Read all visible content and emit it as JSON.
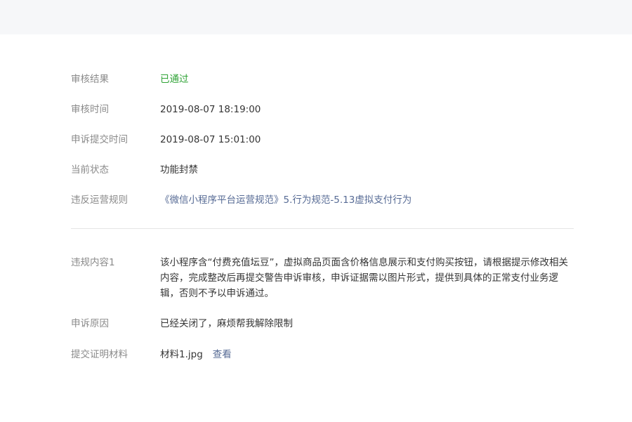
{
  "review": {
    "result_label": "审核结果",
    "result_value": "已通过",
    "time_label": "审核时间",
    "time_value": "2019-08-07 18:19:00",
    "appeal_time_label": "申诉提交时间",
    "appeal_time_value": "2019-08-07 15:01:00",
    "status_label": "当前状态",
    "status_value": "功能封禁",
    "rule_label": "违反运营规则",
    "rule_value": "《微信小程序平台运营规范》5.行为规范-5.13虚拟支付行为"
  },
  "violation": {
    "content_label": "违规内容1",
    "content_value": "该小程序含“付费充值坛豆”，虚拟商品页面含价格信息展示和支付购买按钮，请根据提示修改相关内容，完成整改后再提交警告申诉审核，申诉证据需以图片形式，提供到具体的正常支付业务逻辑，否则不予以申诉通过。",
    "reason_label": "申诉原因",
    "reason_value": "已经关闭了，麻烦帮我解除限制",
    "material_label": "提交证明材料",
    "material_file": "材料1.jpg",
    "material_view": "查看"
  },
  "colors": {
    "status_ok": "#2fa336",
    "link": "#576b95",
    "label": "#8a8a8a",
    "text": "#353535",
    "top_band": "#f6f7f9"
  }
}
